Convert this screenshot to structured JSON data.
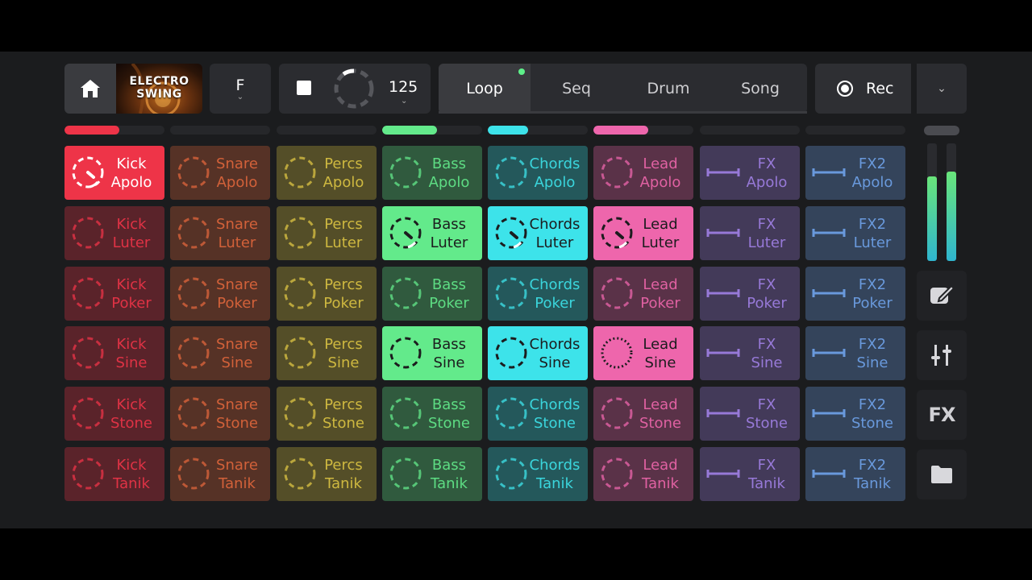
{
  "header": {
    "home_icon": "home-icon",
    "cover_line1": "ELECTRO",
    "cover_line2": "SWING",
    "key": "F",
    "tempo": "125",
    "modes": [
      "Loop",
      "Seq",
      "Drum",
      "Song"
    ],
    "active_mode": "Loop",
    "rec_label": "Rec"
  },
  "tracks": [
    {
      "name": "Kick",
      "color": "#ee3448",
      "level": 0.55
    },
    {
      "name": "Snare",
      "color": "#e0663c",
      "level": 0
    },
    {
      "name": "Percs",
      "color": "#dcc443",
      "level": 0
    },
    {
      "name": "Bass",
      "color": "#63ea8b",
      "level": 0.55
    },
    {
      "name": "Chords",
      "color": "#3de3ea",
      "level": 0.4
    },
    {
      "name": "Lead",
      "color": "#ee66ac",
      "level": 0.55
    },
    {
      "name": "FX",
      "color": "#a181e6",
      "level": 0
    },
    {
      "name": "FX2",
      "color": "#6fa3ea",
      "level": 0
    }
  ],
  "rows": [
    "Apolo",
    "Luter",
    "Poker",
    "Sine",
    "Stone",
    "Tanik"
  ],
  "active_pads": [
    [
      0,
      0
    ],
    [
      1,
      3
    ],
    [
      1,
      4
    ],
    [
      1,
      5
    ],
    [
      3,
      3
    ],
    [
      3,
      4
    ],
    [
      3,
      5
    ]
  ],
  "playing_pads": [
    [
      0,
      0
    ],
    [
      1,
      3
    ],
    [
      1,
      4
    ],
    [
      1,
      5
    ]
  ],
  "mixer": {
    "left_level": 0.72,
    "right_level": 0.76
  },
  "side_buttons": [
    {
      "name": "edit-icon"
    },
    {
      "name": "mixer-sliders-icon"
    },
    {
      "name": "fx-button",
      "label": "FX"
    },
    {
      "name": "folder-icon"
    }
  ]
}
